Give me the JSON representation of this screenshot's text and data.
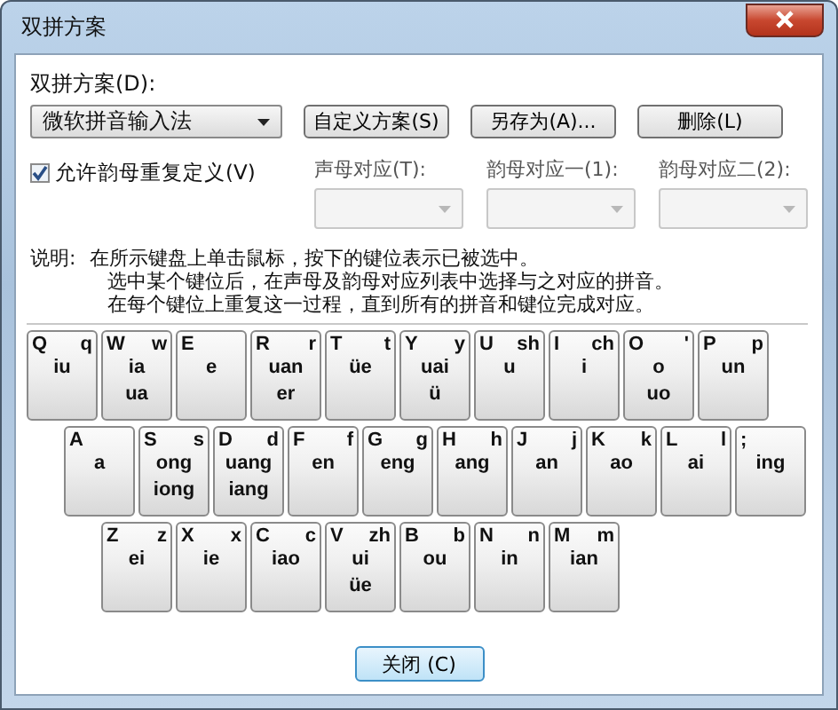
{
  "window": {
    "title": "双拼方案"
  },
  "scheme": {
    "label": "双拼方案(D):",
    "value": "微软拼音输入法"
  },
  "buttons": [
    "自定义方案(S)",
    "另存为(A)...",
    "删除(L)"
  ],
  "allow_repeat": {
    "label": "允许韵母重复定义(V)",
    "checked": true
  },
  "mappings": [
    {
      "label": "声母对应(T):",
      "disabled": true
    },
    {
      "label": "韵母对应一(1):",
      "disabled": true
    },
    {
      "label": "韵母对应二(2):",
      "disabled": true
    }
  ],
  "note": {
    "label": "说明:",
    "lines": [
      "在所示键盘上单击鼠标，按下的键位表示已被选中。",
      "选中某个键位后，在声母及韵母对应列表中选择与之对应的拼音。",
      "在每个键位上重复这一过程，直到所有的拼音和键位完成对应。"
    ]
  },
  "keyboard": {
    "top_keys": [
      {
        "key": "Q",
        "initial": "q",
        "finals": [
          "iu"
        ]
      },
      {
        "key": "W",
        "initial": "w",
        "finals": [
          "ia",
          "ua"
        ]
      },
      {
        "key": "E",
        "finals": [
          "e"
        ]
      },
      {
        "key": "R",
        "initial": "r",
        "finals": [
          "uan",
          "er"
        ]
      },
      {
        "key": "T",
        "initial": "t",
        "finals": [
          "üe"
        ]
      },
      {
        "key": "Y",
        "initial": "y",
        "finals": [
          "uai",
          "ü"
        ]
      },
      {
        "key": "U",
        "initial": "sh",
        "finals": [
          "u"
        ]
      },
      {
        "key": "I",
        "initial": "ch",
        "finals": [
          "i"
        ]
      },
      {
        "key": "O",
        "initial": "'",
        "finals": [
          "o",
          "uo"
        ]
      },
      {
        "key": "P",
        "initial": "p",
        "finals": [
          "un"
        ]
      }
    ],
    "home_keys": [
      {
        "key": "A",
        "finals": [
          "a"
        ]
      },
      {
        "key": "S",
        "initial": "s",
        "finals": [
          "ong",
          "iong"
        ]
      },
      {
        "key": "D",
        "initial": "d",
        "finals": [
          "uang",
          "iang"
        ]
      },
      {
        "key": "F",
        "initial": "f",
        "finals": [
          "en"
        ]
      },
      {
        "key": "G",
        "initial": "g",
        "finals": [
          "eng"
        ]
      },
      {
        "key": "H",
        "initial": "h",
        "finals": [
          "ang"
        ]
      },
      {
        "key": "J",
        "initial": "j",
        "finals": [
          "an"
        ]
      },
      {
        "key": "K",
        "initial": "k",
        "finals": [
          "ao"
        ]
      },
      {
        "key": "L",
        "initial": "l",
        "finals": [
          "ai"
        ]
      },
      {
        "key": ";",
        "finals": [
          "ing"
        ]
      }
    ],
    "bottom_keys": [
      {
        "key": "Z",
        "initial": "z",
        "finals": [
          "ei"
        ]
      },
      {
        "key": "X",
        "initial": "x",
        "finals": [
          "ie"
        ]
      },
      {
        "key": "C",
        "initial": "c",
        "finals": [
          "iao"
        ]
      },
      {
        "key": "V",
        "initial": "zh",
        "finals": [
          "ui",
          "üe"
        ]
      },
      {
        "key": "B",
        "initial": "b",
        "finals": [
          "ou"
        ]
      },
      {
        "key": "N",
        "initial": "n",
        "finals": [
          "in"
        ]
      },
      {
        "key": "M",
        "initial": "m",
        "finals": [
          "ian"
        ]
      }
    ]
  },
  "close_button": "关闭 (C)"
}
